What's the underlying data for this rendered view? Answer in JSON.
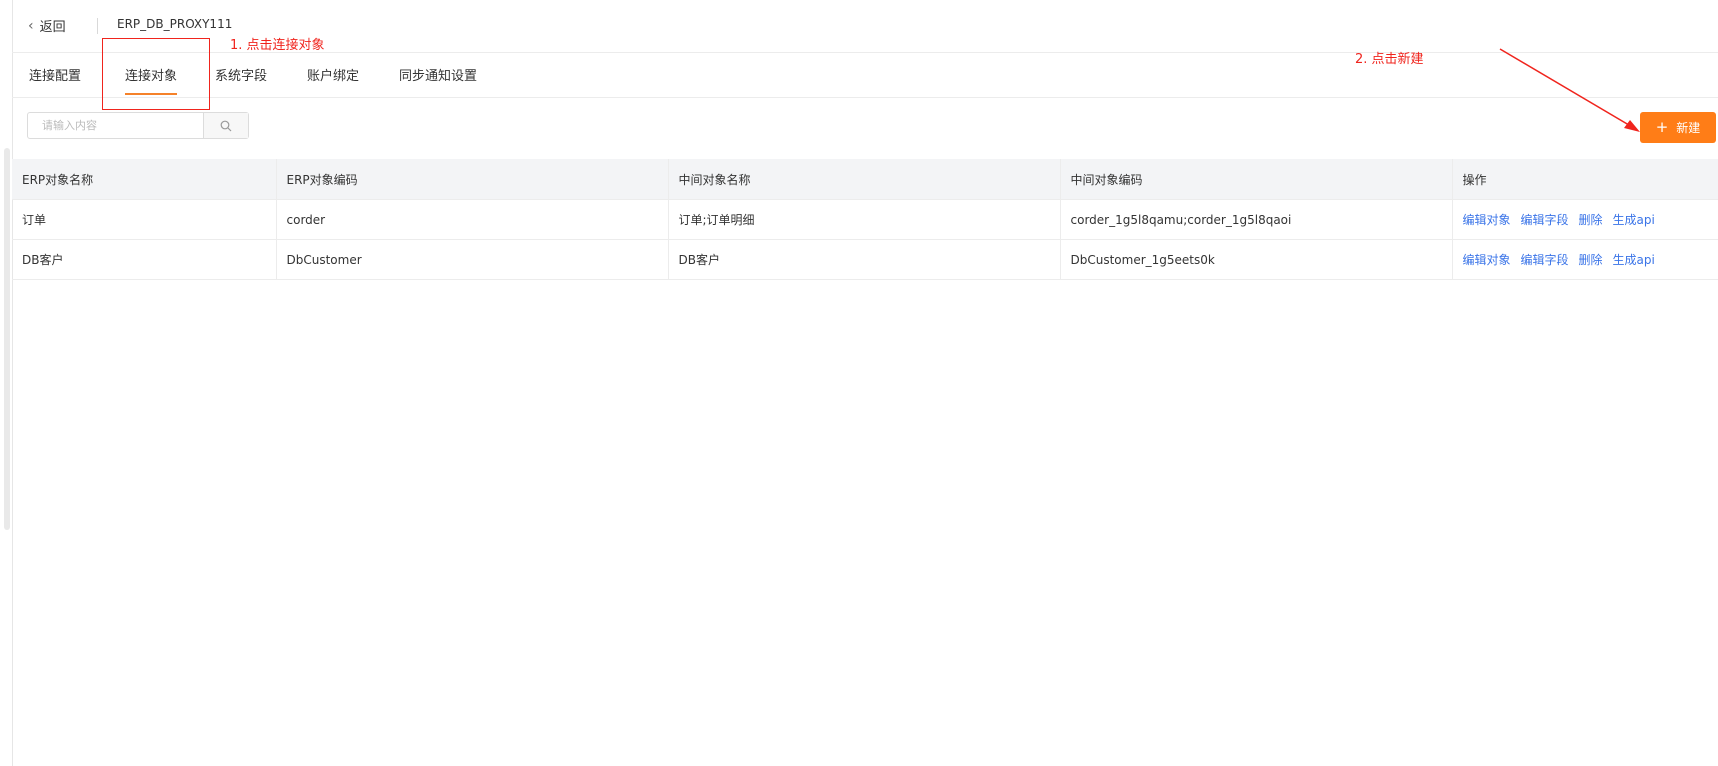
{
  "header": {
    "back_label": "返回",
    "title": "ERP_DB_PROXY111"
  },
  "tabs": [
    {
      "label": "连接配置"
    },
    {
      "label": "连接对象",
      "active": true
    },
    {
      "label": "系统字段"
    },
    {
      "label": "账户绑定"
    },
    {
      "label": "同步通知设置"
    }
  ],
  "search": {
    "placeholder": "请输入内容",
    "value": ""
  },
  "toolbar": {
    "new_label": "新建"
  },
  "table": {
    "columns": [
      "ERP对象名称",
      "ERP对象编码",
      "中间对象名称",
      "中间对象编码",
      "操作"
    ],
    "rows": [
      {
        "erp_name": "订单",
        "erp_code": "corder",
        "mid_name": "订单;订单明细",
        "mid_code": "corder_1g5l8qamu;corder_1g5l8qaoi"
      },
      {
        "erp_name": "DB客户",
        "erp_code": "DbCustomer",
        "mid_name": "DB客户",
        "mid_code": "DbCustomer_1g5eets0k"
      }
    ],
    "actions": [
      "编辑对象",
      "编辑字段",
      "删除",
      "生成api"
    ]
  },
  "annotations": {
    "step1": "1.  点击连接对象",
    "step2": "2.  点击新建",
    "color": "#f0241d"
  },
  "colors": {
    "accent": "#ff7d17",
    "link": "#3a74e8",
    "tab_underline": "#f5822a"
  }
}
